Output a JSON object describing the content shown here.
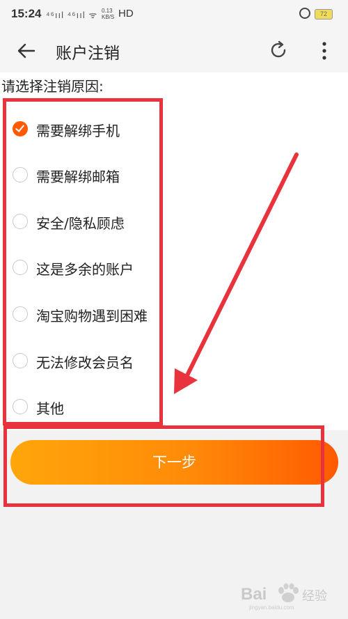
{
  "status_bar": {
    "time": "15:24",
    "signal": "⁴⁶ııl ⁴⁶ııl ᯤ",
    "speed": "0.13\nKB/S",
    "network": "HD",
    "battery": "72"
  },
  "header": {
    "title": "账户注销"
  },
  "prompt": "请选择注销原因:",
  "options": [
    {
      "label": "需要解绑手机",
      "checked": true
    },
    {
      "label": "需要解绑邮箱",
      "checked": false
    },
    {
      "label": "安全/隐私顾虑",
      "checked": false
    },
    {
      "label": "这是多余的账户",
      "checked": false
    },
    {
      "label": "淘宝购物遇到困难",
      "checked": false
    },
    {
      "label": "无法修改会员名",
      "checked": false
    },
    {
      "label": "其他",
      "checked": false
    }
  ],
  "next_button": {
    "label": "下一步"
  },
  "watermark": {
    "text": "Bai",
    "cn": "经验",
    "sub": "jingyan.baidu.com"
  },
  "colors": {
    "accent": "#ff5a00",
    "annotation_red": "#e8333d",
    "button_start": "#ffa60a",
    "button_end": "#ff5a00"
  }
}
